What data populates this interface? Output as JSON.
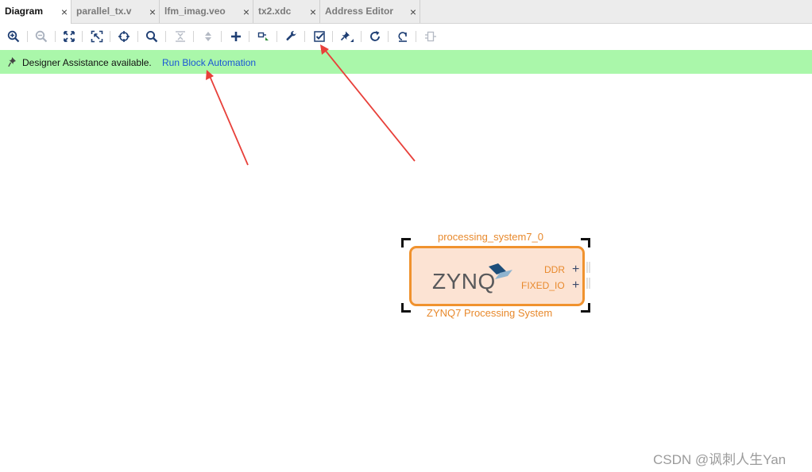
{
  "tabs": [
    {
      "label": "Diagram",
      "active": true
    },
    {
      "label": "parallel_tx.v",
      "active": false
    },
    {
      "label": "lfm_imag.veo",
      "active": false
    },
    {
      "label": "tx2.xdc",
      "active": false
    },
    {
      "label": "Address Editor",
      "active": false
    }
  ],
  "tab_close_glyph": "×",
  "toolbar": {
    "icons": [
      "zoom-in-icon",
      "zoom-out-icon",
      "fit-view-icon",
      "fit-selection-icon",
      "locate-icon",
      "search-icon",
      "collapse-icon",
      "expand-icon",
      "add-ip-icon",
      "make-connection-icon",
      "wrench-icon",
      "validate-icon",
      "pin-icon",
      "refresh-icon",
      "regenerate-layout-icon",
      "disabled-tool-icon"
    ]
  },
  "banner": {
    "message": "Designer Assistance available.",
    "link": "Run Block Automation",
    "background": "#aaf7aa",
    "link_color": "#1a56d6"
  },
  "block": {
    "instance_name": "processing_system7_0",
    "ip_name": "ZYNQ7 Processing System",
    "logo_text": "ZYNQ",
    "ports": [
      "DDR",
      "FIXED_IO"
    ],
    "border_color": "#f0922e",
    "fill_color": "#fce3d3",
    "label_color": "#e8892c"
  },
  "annotation_color": "#e8403a",
  "watermark": "CSDN @讽刺人生Yan"
}
